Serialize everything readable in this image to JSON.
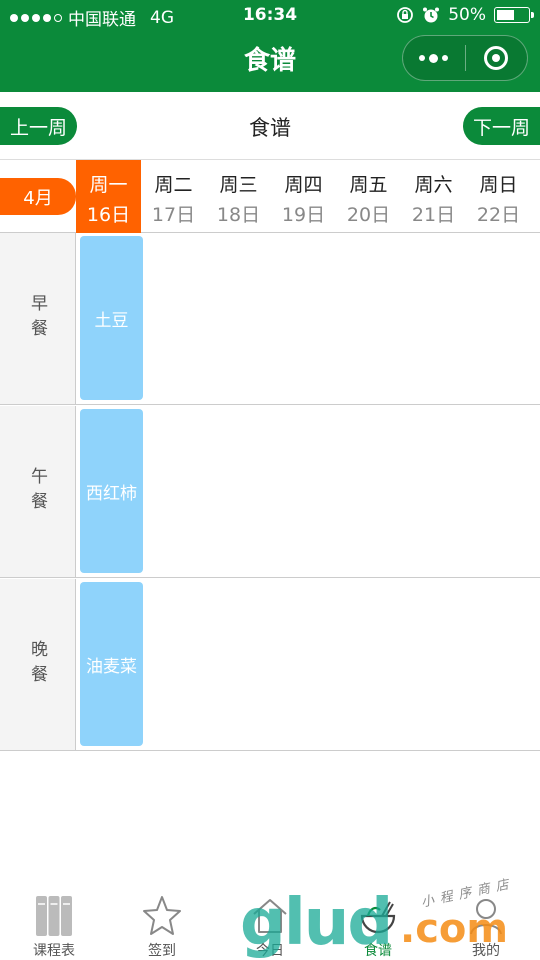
{
  "status": {
    "carrier": "中国联通",
    "network": "4G",
    "time": "16:34",
    "battery": "50%"
  },
  "nav": {
    "title": "食谱"
  },
  "week_nav": {
    "prev_label": "上一周",
    "title": "食谱",
    "next_label": "下一周"
  },
  "month_label": "4月",
  "days": [
    {
      "weekday": "周一",
      "date": "16日",
      "active": true
    },
    {
      "weekday": "周二",
      "date": "17日"
    },
    {
      "weekday": "周三",
      "date": "18日"
    },
    {
      "weekday": "周四",
      "date": "19日"
    },
    {
      "weekday": "周五",
      "date": "20日"
    },
    {
      "weekday": "周六",
      "date": "21日"
    },
    {
      "weekday": "周日",
      "date": "22日"
    }
  ],
  "meals": [
    {
      "label": "早餐",
      "dish": "土豆"
    },
    {
      "label": "午餐",
      "dish": "西红柿"
    },
    {
      "label": "晚餐",
      "dish": "油麦菜"
    }
  ],
  "tabs": [
    {
      "label": "课程表",
      "icon": "books-icon"
    },
    {
      "label": "签到",
      "icon": "star-icon"
    },
    {
      "label": "今日",
      "icon": "home-icon"
    },
    {
      "label": "食谱",
      "icon": "bowl-icon",
      "active": true
    },
    {
      "label": "我的",
      "icon": "user-icon"
    }
  ],
  "colors": {
    "brand_green": "#0b8a3a",
    "accent_orange": "#ff6200",
    "dish_blue": "#8fd3fb"
  },
  "watermark": {
    "main": "glud",
    "suffix": ".com",
    "sub": "小程序商店"
  }
}
